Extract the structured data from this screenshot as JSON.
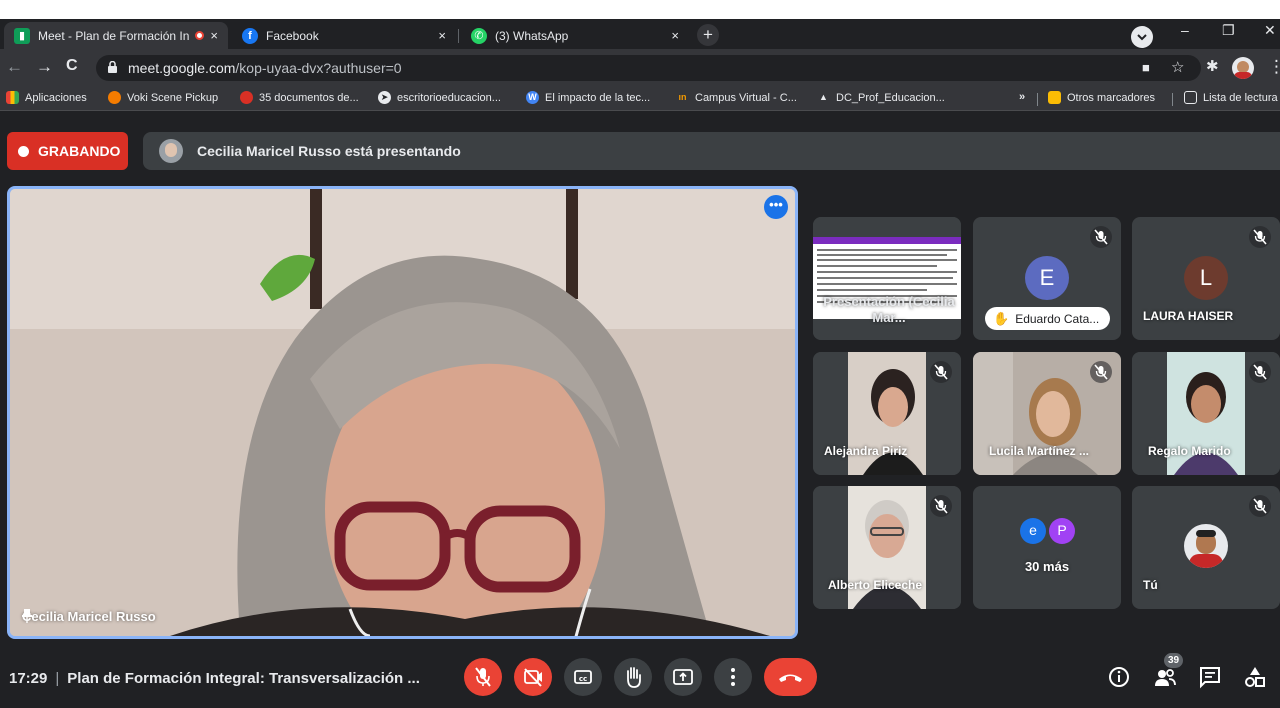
{
  "browser": {
    "tabs": [
      {
        "title": "Meet - Plan de Formación In",
        "icon": "meet-icon",
        "active": true
      },
      {
        "title": "Facebook",
        "icon": "facebook-icon",
        "active": false
      },
      {
        "title": "(3) WhatsApp",
        "icon": "whatsapp-icon",
        "active": false
      }
    ],
    "close_glyph": "×",
    "newtab_glyph": "+",
    "url_host": "meet.google.com",
    "url_path": "/kop-uyaa-dvx?authuser=0",
    "bookmarks": [
      {
        "label": "Aplicaciones",
        "icon": "apps-grid-icon"
      },
      {
        "label": "Voki Scene Pickup",
        "icon": "voki-icon"
      },
      {
        "label": "35 documentos de...",
        "icon": "docs-bookmark-icon"
      },
      {
        "label": "escritorioeducacion...",
        "icon": "escritorio-icon"
      },
      {
        "label": "El impacto de la tec...",
        "icon": "wordpress-icon"
      },
      {
        "label": "Campus Virtual - C...",
        "icon": "campus-icon"
      },
      {
        "label": "DC_Prof_Educacion...",
        "icon": "graduation-cap-icon"
      }
    ],
    "overflow_label": "»",
    "other_bookmarks": "Otros marcadores",
    "reading_list": "Lista de lectura"
  },
  "meet": {
    "recording_label": "GRABANDO",
    "presenting_text": "Cecilia Maricel Russo está presentando",
    "main_participant": "Cecilia Maricel Russo",
    "more_options_glyph": "•••",
    "tiles": [
      {
        "name": "Presentación (Cecilia Mar...",
        "kind": "presentation"
      },
      {
        "name": "Eduardo Cata...",
        "kind": "avatar",
        "initial": "E",
        "hand_raised": true
      },
      {
        "name": "LAURA HAISER",
        "kind": "avatar",
        "initial": "L"
      },
      {
        "name": "Alejandra Piriz",
        "kind": "video"
      },
      {
        "name": "Lucila Martínez ...",
        "kind": "video"
      },
      {
        "name": "Regalo Marido",
        "kind": "video"
      },
      {
        "name": "Alberto Eliceche",
        "kind": "video"
      },
      {
        "name": "30 más",
        "kind": "more",
        "initials": [
          "e",
          "P"
        ]
      },
      {
        "name": "Tú",
        "kind": "self"
      }
    ],
    "time": "17:29",
    "separator": "|",
    "meeting_title": "Plan de Formación Integral: Transversalización ...",
    "participant_count": "39"
  },
  "colors": {
    "accent_blue": "#8ab4f8",
    "record_red": "#d93025",
    "hangup_red": "#ea4335",
    "surface": "#3c4043",
    "background": "#202124",
    "avatar_e": "#5c6bc0",
    "avatar_l": "#6d3b2e",
    "avatar_p": "#a142f4",
    "avatar_e_small": "#1a73e8"
  }
}
